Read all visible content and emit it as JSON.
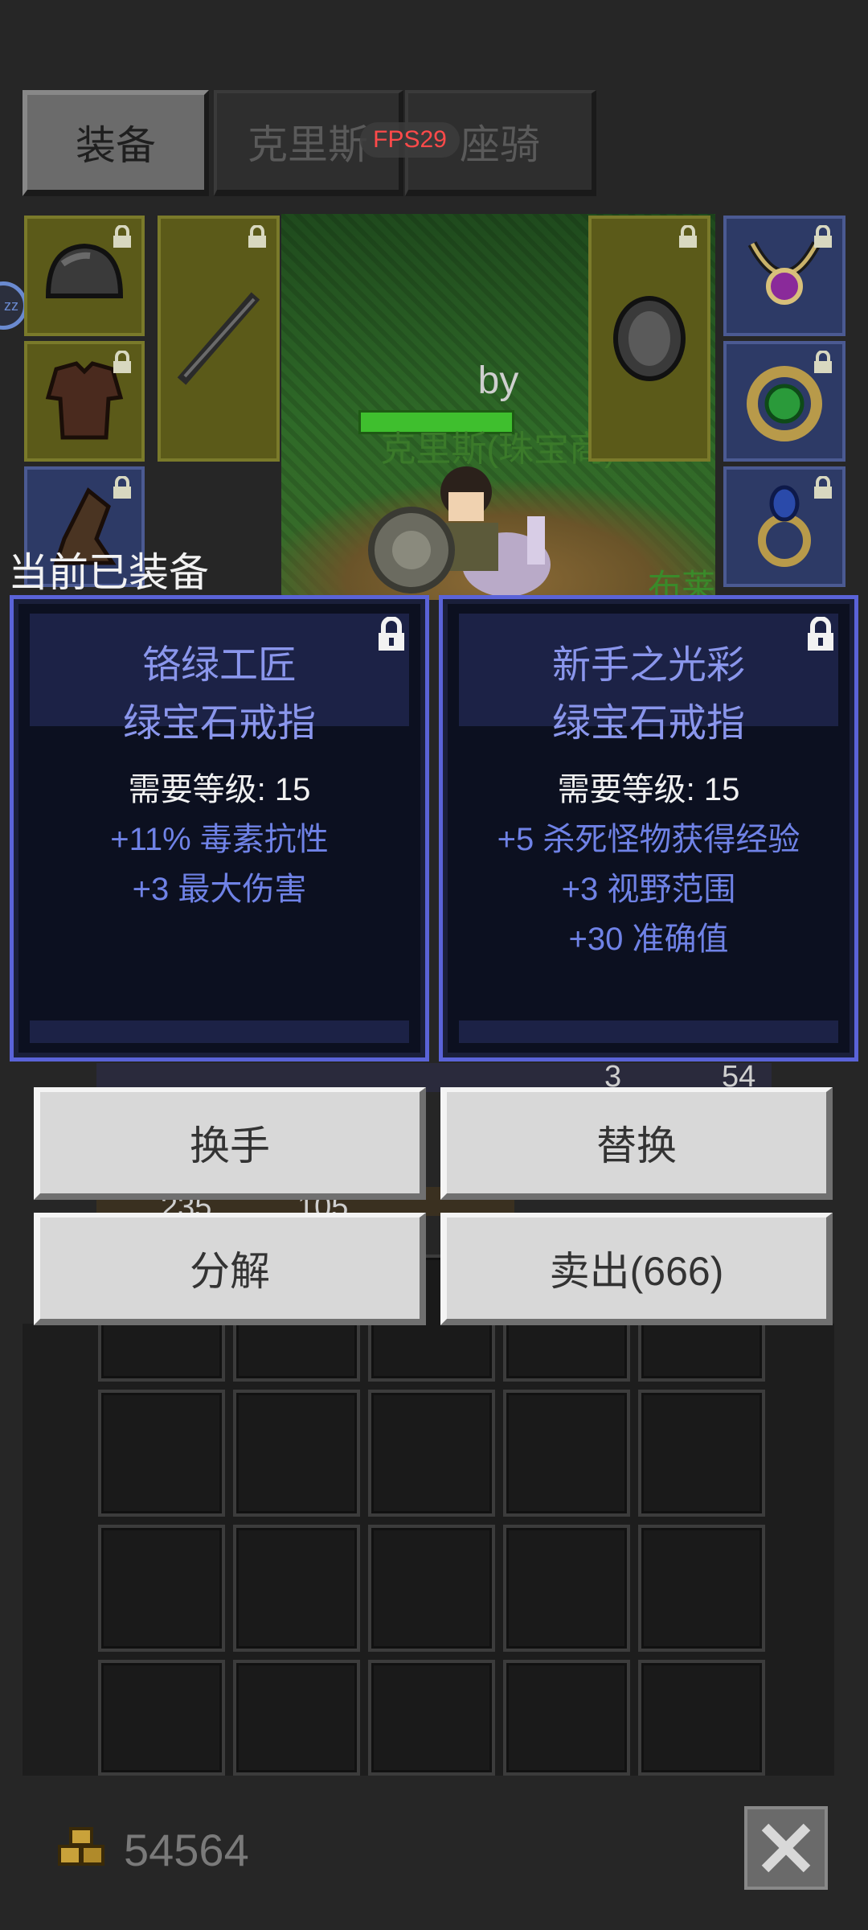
{
  "tabs": [
    {
      "label": "装备",
      "active": true
    },
    {
      "label": "克里斯",
      "active": false
    },
    {
      "label": "座骑",
      "active": false
    }
  ],
  "fps": "FPS29",
  "character": {
    "title": "by",
    "name": "克里斯(珠宝商)",
    "partial_label": "布莱"
  },
  "section_label": "当前已装备",
  "cards": [
    {
      "name_line1": "铬绿工匠",
      "name_line2": "绿宝石戒指",
      "requirement": "需要等级: 15",
      "stats": [
        "+11% 毒素抗性",
        "+3 最大伤害"
      ]
    },
    {
      "name_line1": "新手之光彩",
      "name_line2": "绿宝石戒指",
      "requirement": "需要等级: 15",
      "stats": [
        "+5 杀死怪物获得经验",
        "+3 视野范围",
        "+30 准确值"
      ]
    }
  ],
  "behind_counts": [
    "3",
    "54",
    "235",
    "105"
  ],
  "buttons": {
    "swap_hand": "换手",
    "replace": "替换",
    "dismantle": "分解",
    "sell": "卖出(666)"
  },
  "gold": "54564",
  "icons": {
    "lock": "lock-icon",
    "close": "close-icon",
    "gold": "gold-coins-icon",
    "sleep": "zz-icon"
  },
  "colors": {
    "item_name": "#8a96ec",
    "stat": "#6f82e6",
    "fps": "#ff4a4a",
    "card_border": "#5a63d8"
  }
}
